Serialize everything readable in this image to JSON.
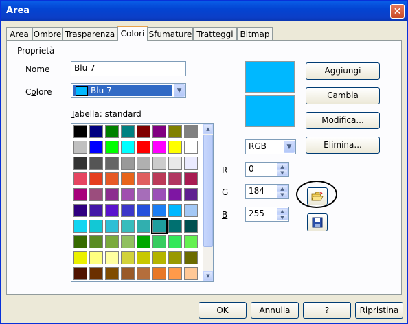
{
  "window": {
    "title": "Area"
  },
  "tabs": [
    "Area",
    "Ombre",
    "Trasparenza",
    "Colori",
    "Sfumature",
    "Tratteggi",
    "Bitmap"
  ],
  "active_tab": "Colori",
  "group": {
    "label": "Proprietà"
  },
  "name_field": {
    "label": "Nome",
    "value": "Blu 7"
  },
  "color_field": {
    "label": "Colore",
    "value": "Blu 7",
    "swatch": "#00b8ff"
  },
  "table_label": "Tabella: standard",
  "preview": {
    "top": "#00b8ff",
    "bottom": "#00b8ff"
  },
  "model_select": {
    "value": "RGB"
  },
  "components": [
    {
      "label": "R",
      "value": "0"
    },
    {
      "label": "G",
      "value": "184"
    },
    {
      "label": "B",
      "value": "255"
    }
  ],
  "side_buttons": [
    "Aggiungi",
    "Cambia",
    "Modifica...",
    "Elimina..."
  ],
  "icons": {
    "open": "folder-open-icon",
    "save": "floppy-save-icon"
  },
  "palette": {
    "selected": [
      6,
      5
    ],
    "rows": [
      [
        "#000000",
        "#000080",
        "#008000",
        "#008080",
        "#800000",
        "#800080",
        "#808000",
        "#808080"
      ],
      [
        "#c0c0c0",
        "#0000ff",
        "#00ff00",
        "#00ffff",
        "#ff0000",
        "#ff00ff",
        "#ffff00",
        "#ffffff"
      ],
      [
        "#333333",
        "#555555",
        "#666666",
        "#999999",
        "#b0b0b0",
        "#cccccc",
        "#e8e8e8",
        "#ebebff"
      ],
      [
        "#e64661",
        "#e53e1e",
        "#e75a26",
        "#e8641b",
        "#e06060",
        "#bb3b59",
        "#b13762",
        "#a81c52"
      ],
      [
        "#a7007a",
        "#9b4d7d",
        "#8c2d8f",
        "#a04faf",
        "#a66db9",
        "#9b4fb7",
        "#7e16a3",
        "#602090"
      ],
      [
        "#300080",
        "#4419a8",
        "#5a13cd",
        "#3c36c8",
        "#2550dc",
        "#1c7ef3",
        "#00b8ff",
        "#a3c8f5"
      ],
      [
        "#12d5f1",
        "#12c8d5",
        "#2ebfd6",
        "#37bdbd",
        "#31afaf",
        "#1e9e9e",
        "#007070",
        "#005050"
      ],
      [
        "#376b00",
        "#5a8c23",
        "#7aaa3c",
        "#90c060",
        "#00a800",
        "#38cc60",
        "#33e85a",
        "#64f050"
      ],
      [
        "#ebf000",
        "#ffff7f",
        "#ffffa0",
        "#d2d23a",
        "#c8c800",
        "#b4b400",
        "#999900",
        "#6b6b00"
      ],
      [
        "#501400",
        "#6b3000",
        "#804c00",
        "#9a5a28",
        "#b46e3c",
        "#e87826",
        "#ff9a4a",
        "#ffc896"
      ]
    ]
  },
  "footer": [
    "OK",
    "Annulla",
    "?",
    "Ripristina"
  ]
}
